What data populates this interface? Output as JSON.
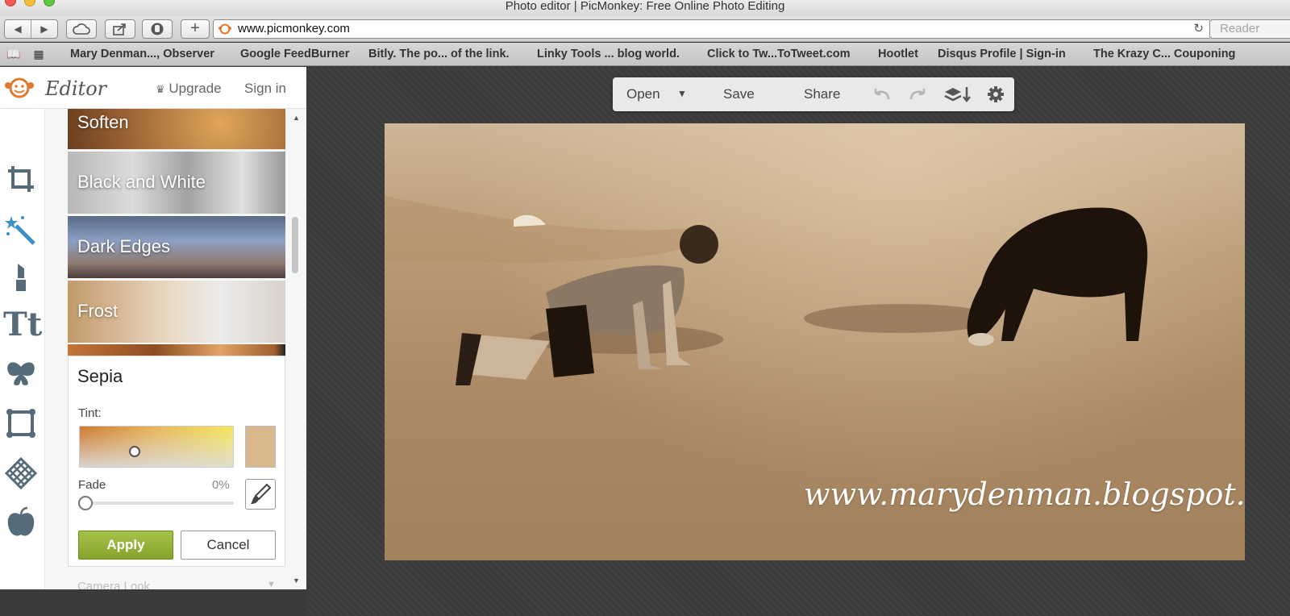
{
  "window": {
    "title": "Photo editor | PicMonkey: Free Online Photo Editing"
  },
  "browser": {
    "url": "www.picmonkey.com",
    "reader_label": "Reader",
    "bookmarks": [
      "Mary Denman..., Observer",
      "Google FeedBurner",
      "Bitly. The po... of the link.",
      "Linky Tools ... blog world.",
      "Click to Tw...ToTweet.com",
      "Hootlet",
      "Disqus Profile | Sign-in",
      "The Krazy C... Couponing"
    ]
  },
  "panel": {
    "logo_text": "Editor",
    "upgrade_label": "Upgrade",
    "signin_label": "Sign in",
    "effects": [
      "Soften",
      "Black and White",
      "Dark Edges",
      "Frost"
    ],
    "active_effect": {
      "title": "Sepia",
      "tint_label": "Tint:",
      "tint_color": "#d9b88e",
      "fade_label": "Fade",
      "fade_value": "0%",
      "apply_label": "Apply",
      "cancel_label": "Cancel"
    },
    "next_effect": "Camera Look"
  },
  "editor_toolbar": {
    "open_label": "Open",
    "save_label": "Save",
    "share_label": "Share"
  },
  "photo": {
    "watermark": "www.marydenman.blogspot.com"
  },
  "colors": {
    "apply_green": "#94b33a",
    "canvas_bg": "#3b3b3b",
    "logo_orange": "#e07a2f"
  }
}
